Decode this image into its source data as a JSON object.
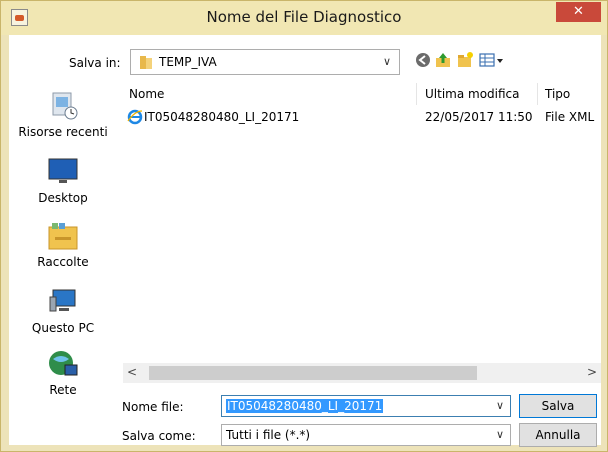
{
  "window": {
    "title": "Nome del File Diagnostico",
    "close_glyph": "✕"
  },
  "save_in": {
    "label": "Salva in:",
    "value": "TEMP_IVA",
    "chevron": "∨"
  },
  "toolbar": {
    "icons": [
      "back-icon",
      "up-folder-icon",
      "new-folder-icon",
      "view-menu-icon"
    ]
  },
  "places": [
    {
      "label": "Risorse recenti",
      "icon": "recent-places-icon"
    },
    {
      "label": "Desktop",
      "icon": "desktop-icon"
    },
    {
      "label": "Raccolte",
      "icon": "libraries-icon"
    },
    {
      "label": "Questo PC",
      "icon": "this-pc-icon"
    },
    {
      "label": "Rete",
      "icon": "network-icon"
    }
  ],
  "file_list": {
    "columns": [
      "Nome",
      "Ultima modifica",
      "Tipo"
    ],
    "rows": [
      {
        "name": "IT05048280480_LI_20171",
        "modified": "22/05/2017 11:50",
        "type": "File XML",
        "icon": "xml-file-icon"
      }
    ]
  },
  "scrollbar": {
    "left": "<",
    "right": ">"
  },
  "filename": {
    "label": "Nome file:",
    "value": "IT05048280480_LI_20171",
    "chevron": "∨"
  },
  "filetype": {
    "label": "Salva come:",
    "value": "Tutti i file (*.*)",
    "chevron": "∨"
  },
  "buttons": {
    "save": "Salva",
    "cancel": "Annulla"
  }
}
